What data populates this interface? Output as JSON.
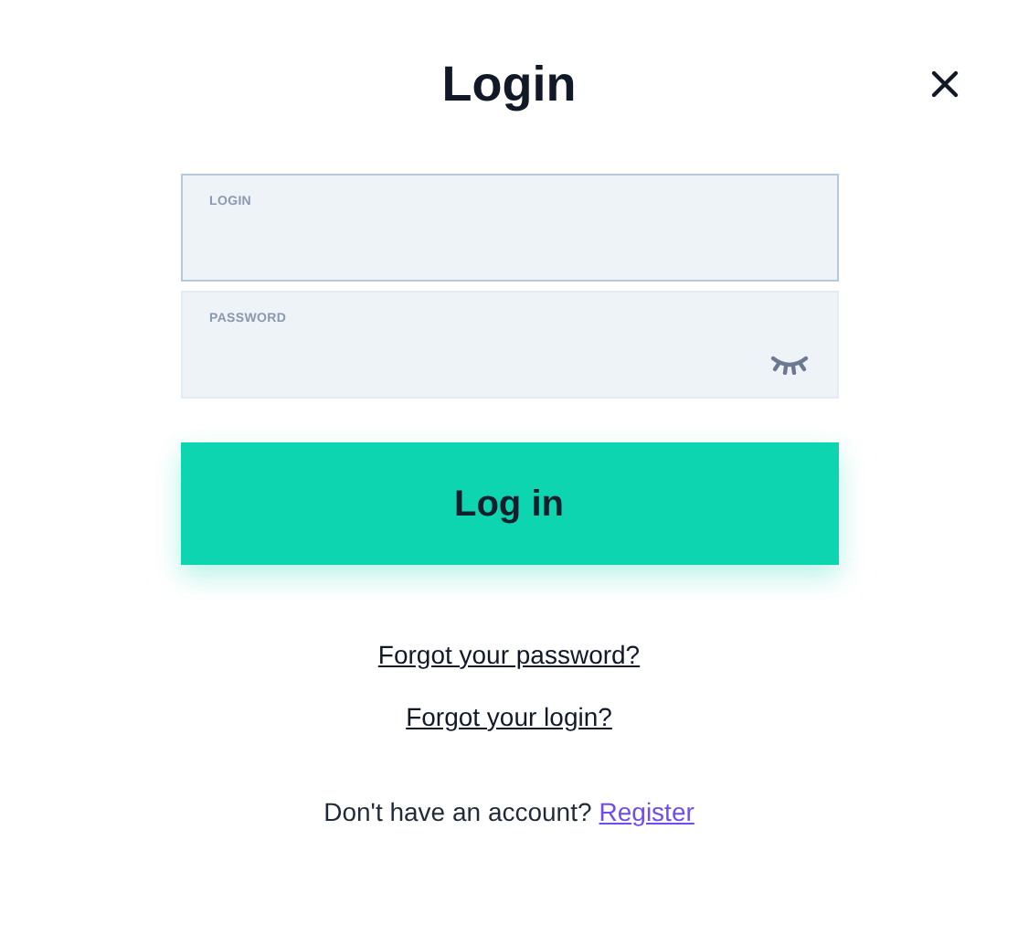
{
  "title": "Login",
  "fields": [
    {
      "label": "LOGIN",
      "focused": true,
      "kind": "text"
    },
    {
      "label": "PASSWORD",
      "focused": false,
      "kind": "password"
    }
  ],
  "submit": "Log in",
  "links": [
    "Forgot your password?",
    "Forgot your login?"
  ],
  "footer": {
    "text": "Don't have an account?",
    "link": "Register"
  }
}
